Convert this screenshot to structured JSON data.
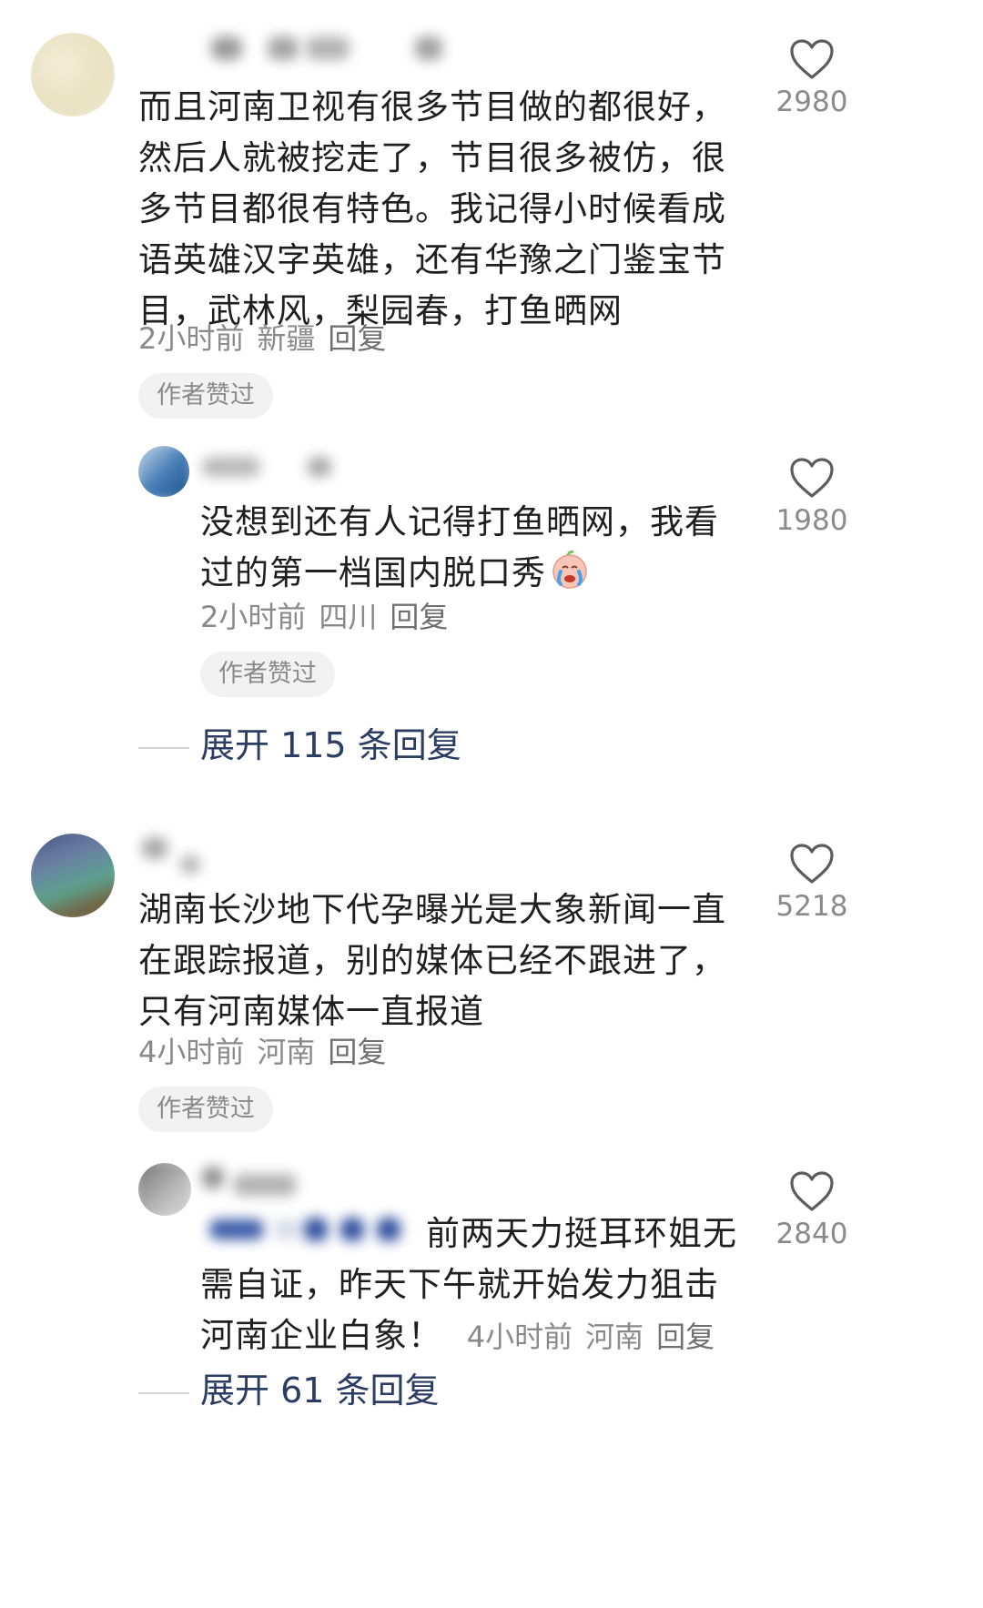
{
  "comments": [
    {
      "text": "而且河南卫视有很多节目做的都很好，然后人就被挖走了，节目很多被仿，很多节目都很有特色。我记得小时候看成语英雄汉字英雄，还有华豫之门鉴宝节目，武林风，梨园春，打鱼晒网",
      "time": "2小时前",
      "location": "新疆",
      "reply_label": "回复",
      "author_liked": "作者赞过",
      "likes": "2980",
      "replies": [
        {
          "text": "没想到还有人记得打鱼晒网，我看过的第一档国内脱口秀",
          "emoji": "crying-face-emoji",
          "time": "2小时前",
          "location": "四川",
          "reply_label": "回复",
          "author_liked": "作者赞过",
          "likes": "1980"
        }
      ],
      "expand_label": "展开 115 条回复"
    },
    {
      "text": "湖南长沙地下代孕曝光是大象新闻一直在跟踪报道，别的媒体已经不跟进了，只有河南媒体一直报道",
      "time": "4小时前",
      "location": "河南",
      "reply_label": "回复",
      "author_liked": "作者赞过",
      "likes": "5218",
      "replies": [
        {
          "text": "前两天力挺耳环姐无需自证，昨天下午就开始发力狙击河南企业白象！",
          "time": "4小时前",
          "location": "河南",
          "reply_label": "回复",
          "likes": "2840"
        }
      ],
      "expand_label": "展开 61 条回复"
    }
  ],
  "colors": {
    "text": "#1f1f1f",
    "meta": "#8a8a8a",
    "expand": "#2b3d62",
    "pill_bg": "#f2f2f2"
  },
  "icons": [
    "heart-outline-icon"
  ]
}
